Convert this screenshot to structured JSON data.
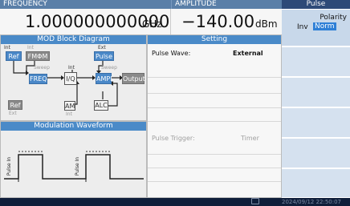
{
  "frequency": {
    "label": "FREQUENCY",
    "value": "1.000000000000",
    "unit": "GHz"
  },
  "amplitude": {
    "label": "AMPLITUDE",
    "value": "−140.00",
    "unit": "dBm"
  },
  "mod_block": {
    "title": "MOD Block Diagram",
    "int_label_1": "Int",
    "int_label_2": "Int",
    "ext_label_1": "Ext",
    "ref_label": "Ref",
    "fm_label": "FMΦM",
    "pulse_label": "Pulse",
    "sweep_label_1": "Sweep",
    "sweep_label_2": "Sweep",
    "int_label_3": "Int",
    "freq_label": "FREQ",
    "iq_label": "I/Q",
    "ampl_label": "AMPL",
    "output_label": "Output",
    "ref_bottom_label": "Ref",
    "ext_label_2": "Ext",
    "am_label": "AM",
    "int_label_4": "Int",
    "alc_label": "ALC"
  },
  "waveform": {
    "title": "Modulation Waveform",
    "pulse_in_1": "Pulse In",
    "pulse_in_2": "Pulse In"
  },
  "setting": {
    "title": "Setting",
    "pulse_wave_label": "Pulse Wave:",
    "pulse_wave_value": "External",
    "pulse_trigger_label": "Pulse Trigger:",
    "pulse_trigger_value": "Timer"
  },
  "softkeys": {
    "title": "Pulse",
    "polarity_label": "Polarity",
    "polarity_inv": "Inv",
    "polarity_norm": "Norm"
  },
  "status_bar": {
    "timestamp": "2024/09/12 22:50:07"
  },
  "colors": {
    "accent": "#4a88c8",
    "header": "#5a7fa8",
    "softkey": "#d5e1ef",
    "status_bar": "#0f1e3a"
  }
}
